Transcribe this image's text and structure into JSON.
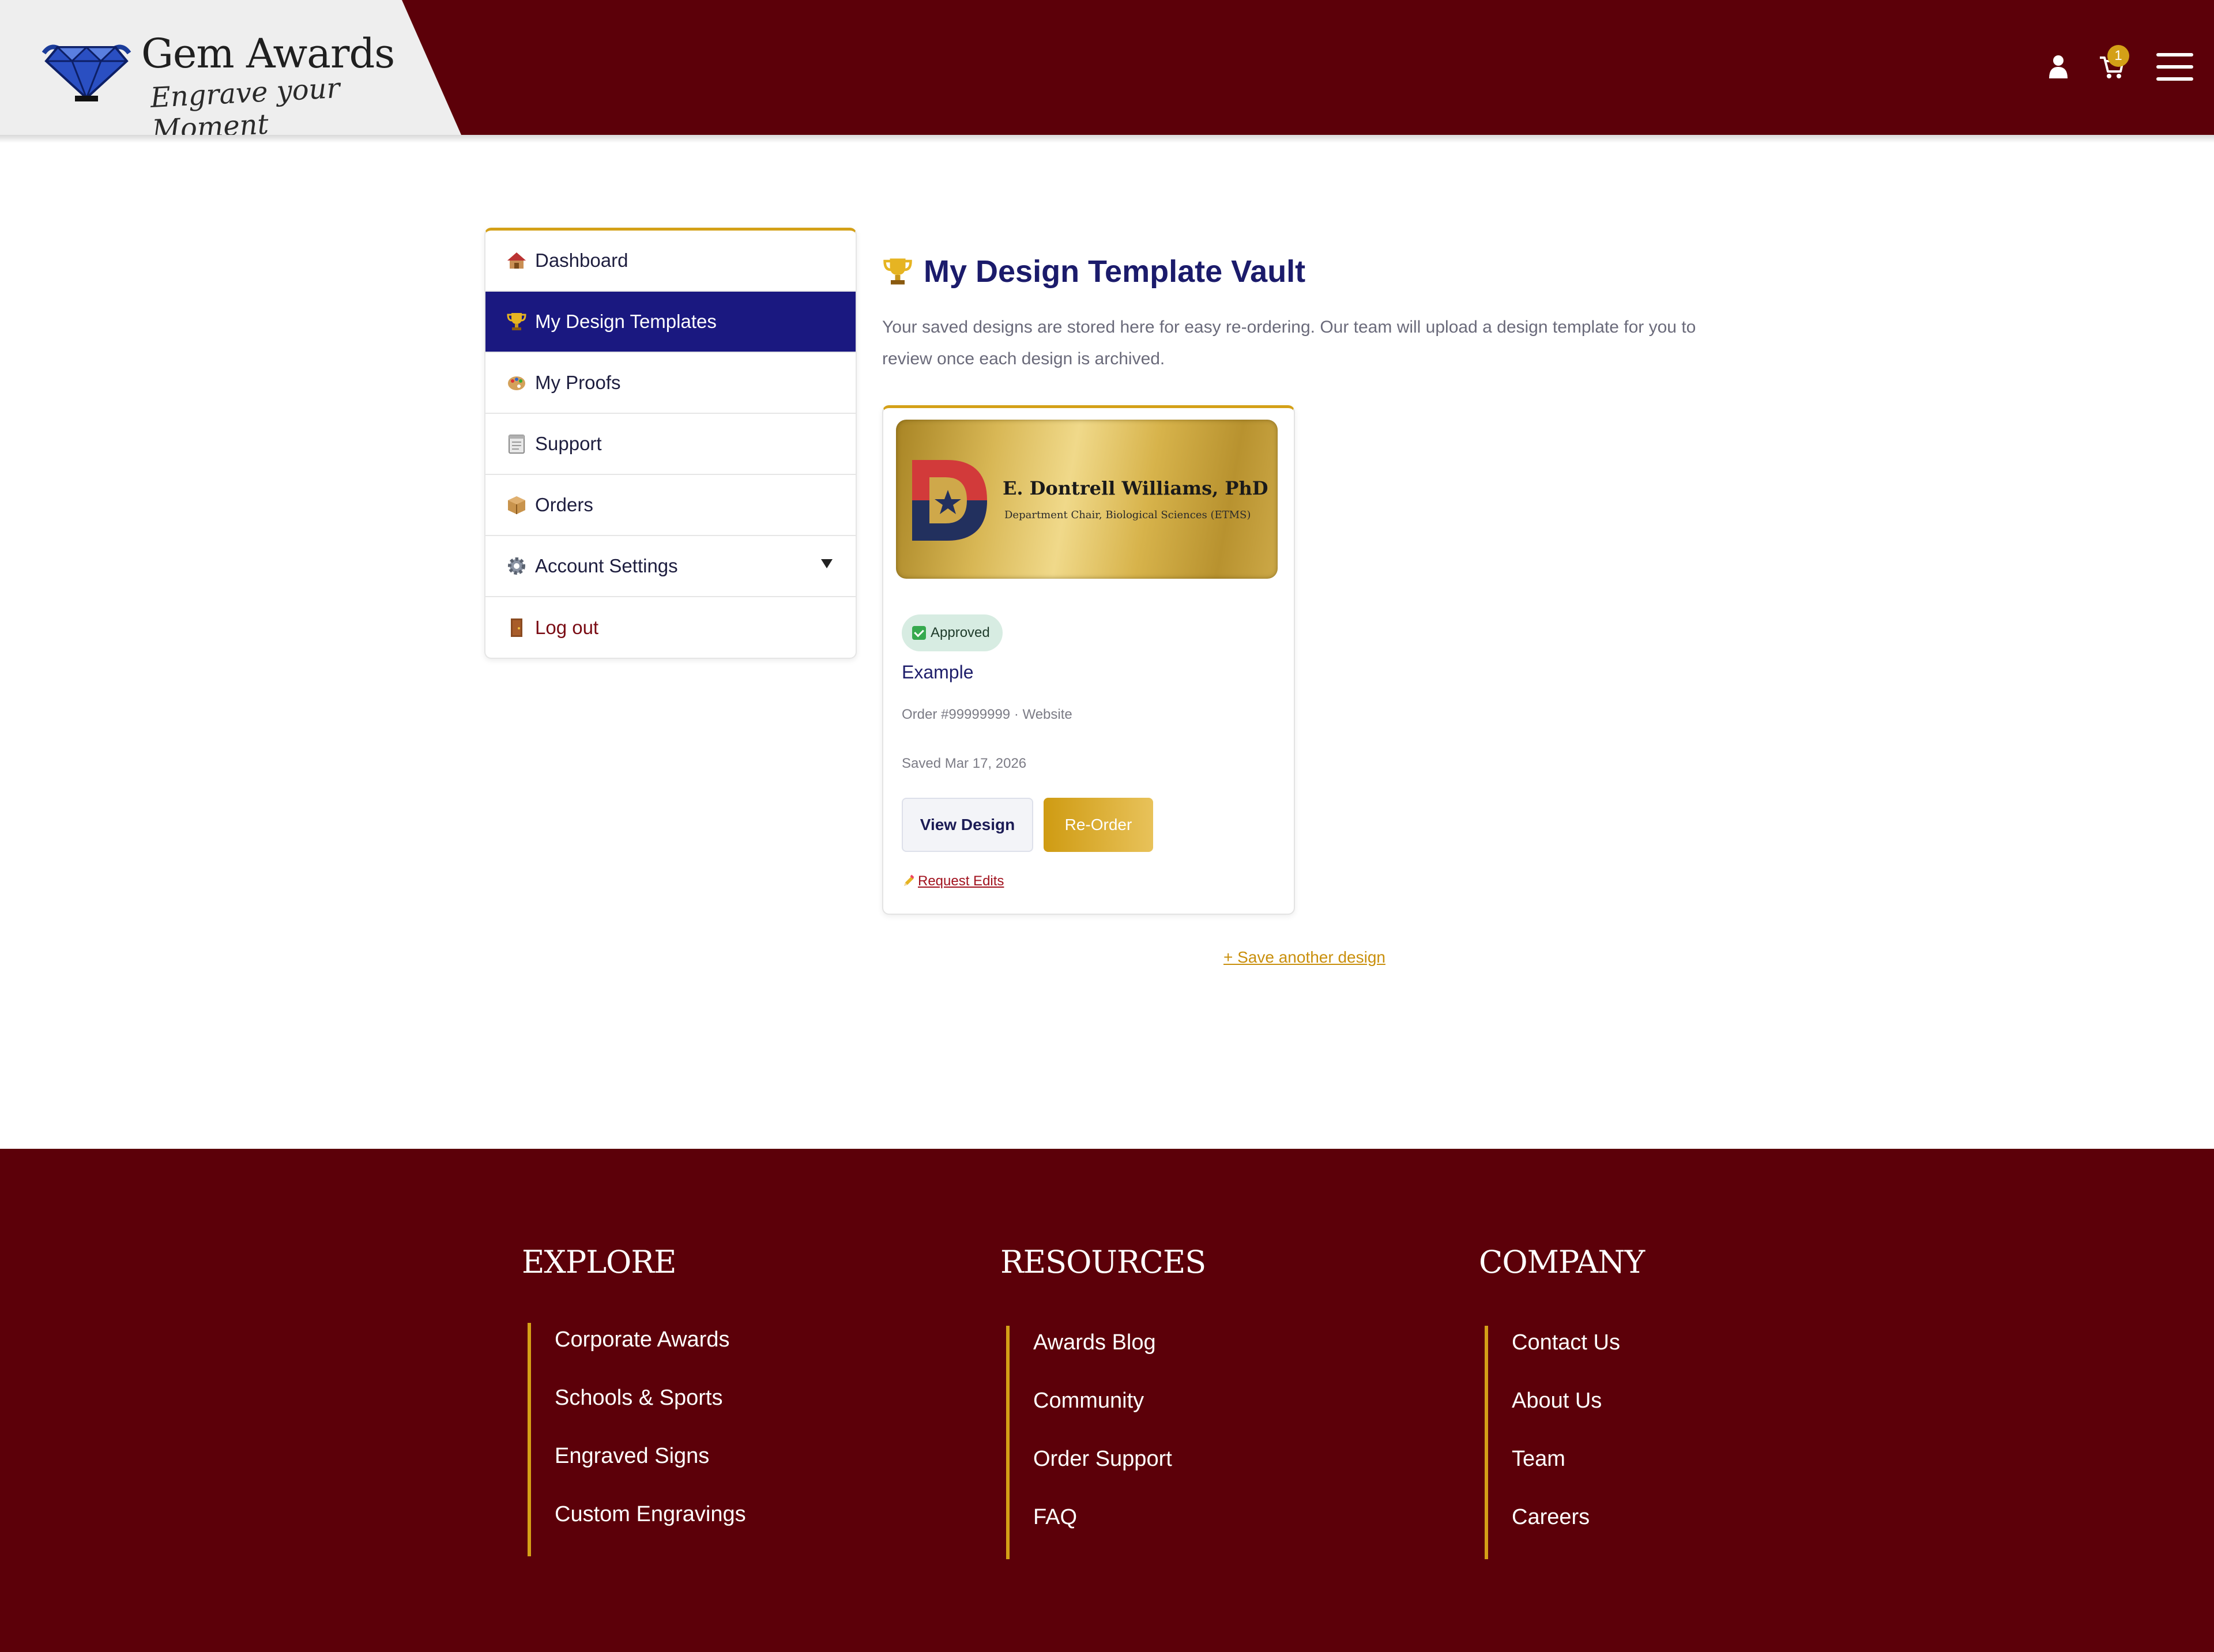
{
  "header": {
    "brand_title": "Gem Awards",
    "brand_tagline": "Engrave your Moment",
    "cart_count": "1",
    "icons": [
      "gem-logo-icon",
      "user-icon",
      "cart-icon",
      "menu-icon"
    ]
  },
  "sidebar": {
    "items": [
      {
        "label": "Dashboard",
        "icon": "house-icon"
      },
      {
        "label": "My Design Templates",
        "icon": "trophy-icon",
        "active": true
      },
      {
        "label": "My Proofs",
        "icon": "palette-icon"
      },
      {
        "label": "Support",
        "icon": "clipboard-icon"
      },
      {
        "label": "Orders",
        "icon": "package-icon"
      },
      {
        "label": "Account Settings",
        "icon": "gear-icon"
      },
      {
        "label": "Log out",
        "icon": "door-icon"
      }
    ]
  },
  "main": {
    "title": "My Design Template Vault",
    "description": "Your saved designs are stored here for easy re-ordering. Our team will upload a design template for you to review once each design is archived.",
    "save_another": "+ Save another design"
  },
  "card": {
    "plaque_name": "E. Dontrell Williams, PhD",
    "plaque_subtitle": "Department Chair, Biological Sciences (ETMS)",
    "status": "Approved",
    "design_name": "Example",
    "order_meta": "Order #99999999 · Website",
    "saved_date": "Saved Mar 17, 2026",
    "view_button": "View Design",
    "reorder_button": "Re-Order",
    "request_edits": "Request Edits"
  },
  "footer": {
    "explore": {
      "heading": "EXPLORE",
      "links": [
        "Corporate Awards",
        "Schools & Sports",
        "Engraved Signs",
        "Custom Engravings"
      ]
    },
    "resources": {
      "heading": "RESOURCES",
      "links": [
        "Awards Blog",
        "Community",
        "Order Support",
        "FAQ"
      ]
    },
    "company": {
      "heading": "COMPANY",
      "links": [
        "Contact Us",
        "About Us",
        "Team",
        "Careers"
      ]
    }
  },
  "colors": {
    "brand_maroon": "#5c0009",
    "accent_gold": "#d4a017",
    "active_navy": "#1a1880"
  }
}
